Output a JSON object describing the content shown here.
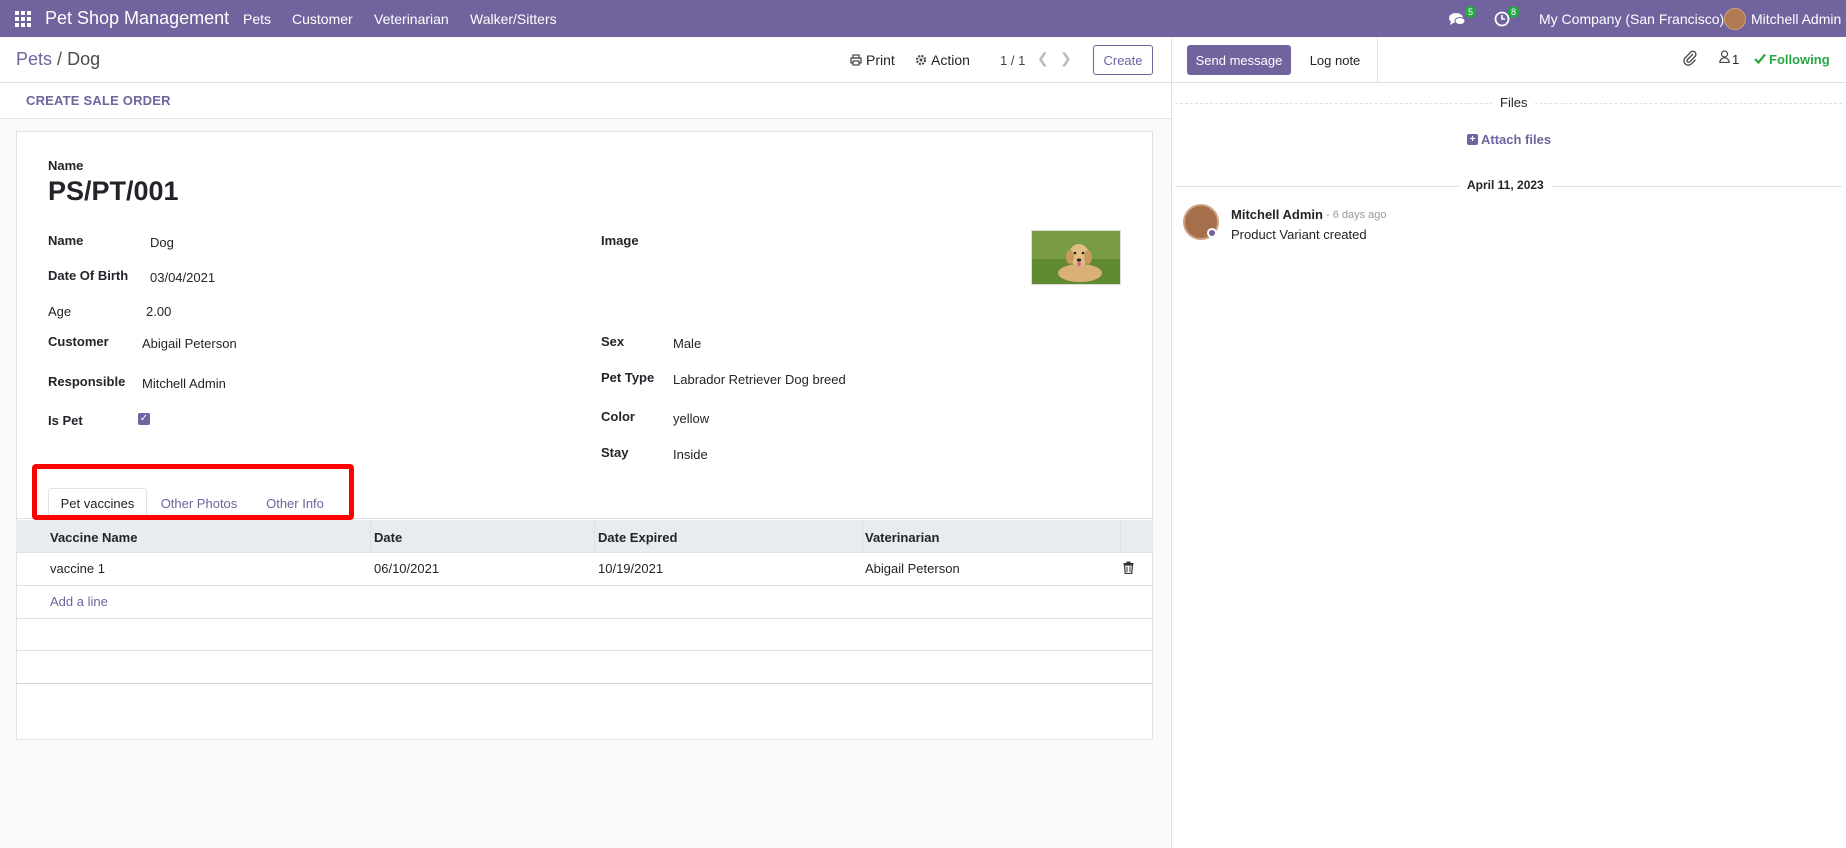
{
  "navbar": {
    "app_name": "Pet Shop Management",
    "menu": [
      "Pets",
      "Customer",
      "Veterinarian",
      "Walker/Sitters"
    ],
    "messages_badge": "5",
    "activities_badge": "8",
    "company": "My Company (San Francisco)",
    "user": "Mitchell Admin"
  },
  "control_panel": {
    "breadcrumb_parent": "Pets",
    "breadcrumb_sep": "/",
    "breadcrumb_current": "Dog",
    "print_label": "Print",
    "action_label": "Action",
    "pager": "1 / 1",
    "create_label": "Create"
  },
  "statusbar": {
    "create_sale_order": "CREATE SALE ORDER"
  },
  "form": {
    "title_label": "Name",
    "title_value": "PS/PT/001",
    "left_fields": {
      "name_label": "Name",
      "name_value": "Dog",
      "dob_label": "Date Of Birth",
      "dob_value": "03/04/2021",
      "age_label": "Age",
      "age_value": "2.00",
      "customer_label": "Customer",
      "customer_value": "Abigail Peterson",
      "responsible_label": "Responsible",
      "responsible_value": "Mitchell Admin",
      "ispet_label": "Is Pet",
      "ispet_checked": true
    },
    "right_fields": {
      "image_label": "Image",
      "sex_label": "Sex",
      "sex_value": "Male",
      "pettype_label": "Pet Type",
      "pettype_value": "Labrador Retriever Dog breed",
      "color_label": "Color",
      "color_value": "yellow",
      "stay_label": "Stay",
      "stay_value": "Inside"
    },
    "tabs": [
      {
        "label": "Pet vaccines",
        "active": true
      },
      {
        "label": "Other Photos",
        "active": false
      },
      {
        "label": "Other Info",
        "active": false
      }
    ],
    "vaccines_table": {
      "columns": [
        "Vaccine Name",
        "Date",
        "Date Expired",
        "Vaterinarian"
      ],
      "rows": [
        [
          "vaccine 1",
          "06/10/2021",
          "10/19/2021",
          "Abigail Peterson"
        ]
      ],
      "add_line": "Add a line"
    }
  },
  "chatter": {
    "send_message": "Send message",
    "log_note": "Log note",
    "follower_count": "1",
    "following": "Following",
    "files_label": "Files",
    "attach_files": "Attach files",
    "date_separator": "April 11, 2023",
    "message": {
      "author": "Mitchell Admin",
      "time": "- 6 days ago",
      "body": "Product Variant created"
    }
  },
  "colors": {
    "brand": "#71639e",
    "success": "#28a745",
    "highlight": "#ff0000"
  }
}
